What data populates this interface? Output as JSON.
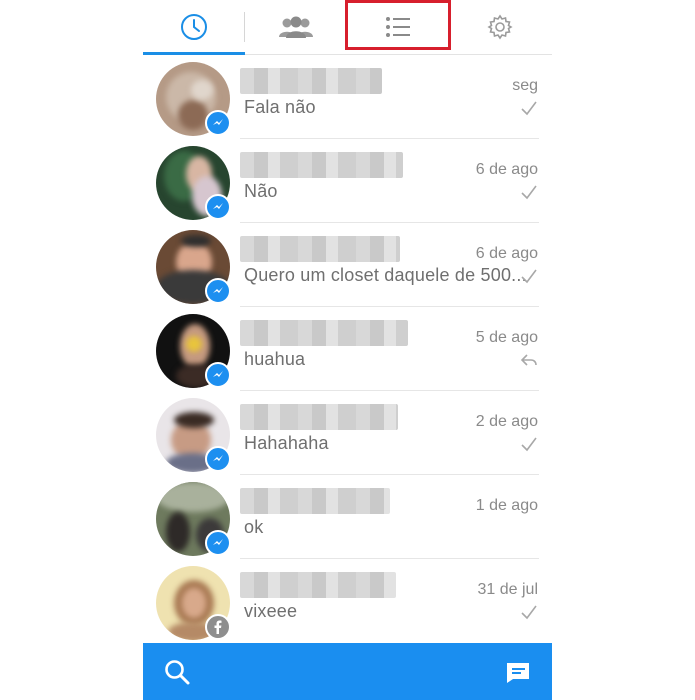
{
  "tabs": [
    {
      "name": "recent",
      "icon": "clock-icon",
      "active": true
    },
    {
      "name": "groups",
      "icon": "people-icon",
      "active": false
    },
    {
      "name": "list",
      "icon": "list-icon",
      "active": false
    },
    {
      "name": "settings",
      "icon": "gear-icon",
      "active": false
    }
  ],
  "colors": {
    "accent": "#1a8ee6",
    "highlight": "#d71f2d",
    "bottombar": "#1a8ef0"
  },
  "conversations": [
    {
      "message": "Fala não",
      "time": "seg",
      "status": "check-icon",
      "badge": "messenger-icon"
    },
    {
      "message": "Não",
      "time": "6 de ago",
      "status": "check-icon",
      "badge": "messenger-icon"
    },
    {
      "message": "Quero um closet daquele de 500...",
      "time": "6 de ago",
      "status": "check-icon",
      "badge": "messenger-icon"
    },
    {
      "message": "huahua",
      "time": "5 de ago",
      "status": "reply-icon",
      "badge": "messenger-icon"
    },
    {
      "message": "Hahahaha",
      "time": "2 de ago",
      "status": "check-icon",
      "badge": "messenger-icon"
    },
    {
      "message": "ok",
      "time": "1 de ago",
      "status": "",
      "badge": "messenger-icon"
    },
    {
      "message": "vixeee",
      "time": "31 de jul",
      "status": "check-icon",
      "badge": "facebook-icon"
    }
  ],
  "bottombar": {
    "left_icon": "search-icon",
    "right_icon": "compose-icon"
  }
}
